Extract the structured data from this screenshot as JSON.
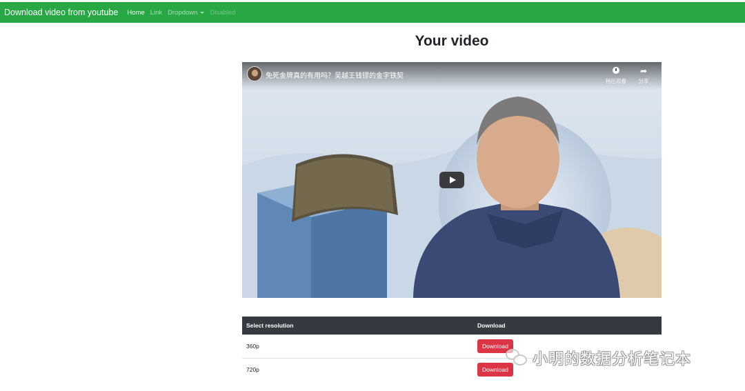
{
  "navbar": {
    "brand": "Download video from youtube",
    "links": [
      {
        "label": "Home"
      },
      {
        "label": "Link"
      },
      {
        "label": "Dropdown"
      },
      {
        "label": "Disabled"
      }
    ],
    "color": "#28a745"
  },
  "page": {
    "title": "Your video"
  },
  "video": {
    "title": "免死金牌真的有用吗？吴越王钱镠的金字铁契",
    "actions": [
      {
        "label": "稍后观看",
        "icon": "clock-icon"
      },
      {
        "label": "分享",
        "icon": "share-icon"
      }
    ]
  },
  "table": {
    "headers": [
      "Select resolution",
      "Download"
    ],
    "rows": [
      {
        "resolution": "360p",
        "button": "Download"
      },
      {
        "resolution": "720p",
        "button": "Download"
      }
    ],
    "button_color": "#dc3545",
    "header_color": "#343a40"
  },
  "watermark": {
    "text": "小明的数据分析笔记本"
  }
}
